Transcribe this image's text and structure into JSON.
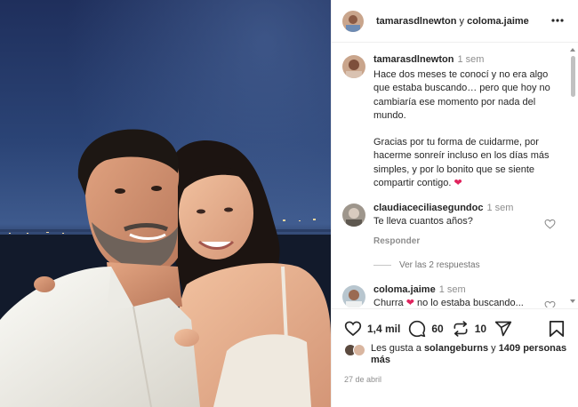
{
  "header": {
    "user1": "tamarasdlnewton",
    "joiner": " y ",
    "user2": "coloma.jaime"
  },
  "caption": {
    "user": "tamarasdlnewton",
    "time": "1 sem",
    "text": "Hace dos meses te conocí y no era algo que estaba buscando… pero que hoy no cambiaría ese momento por nada del mundo.\n\nGracias por tu forma de cuidarme, por hacerme sonreír incluso en los días más simples, y por lo bonito que se siente compartir contigo. ",
    "emoji": "❤"
  },
  "comment1": {
    "user": "claudiaceciliasegundoc",
    "time": "1 sem",
    "text": "Te lleva cuantos años?",
    "reply": "Responder",
    "view_replies": "Ver las 2 respuestas"
  },
  "comment2": {
    "user": "coloma.jaime",
    "time": "1 sem",
    "text_before": "Churra ",
    "emoji": "❤",
    "text_after": " no lo estaba buscando..."
  },
  "actions": {
    "likes": "1,4 mil",
    "comments": "60",
    "reposts": "10"
  },
  "liked_by": {
    "prefix": "Les gusta a ",
    "user": "solangeburns",
    "middle": " y ",
    "others": "1409 personas más"
  },
  "date": "27 de abril",
  "colors": {
    "heart": "#e0245e",
    "muted": "#8e8e8e",
    "text": "#262626"
  },
  "icons": [
    "more-icon",
    "heart-icon",
    "comment-icon",
    "repost-icon",
    "share-icon",
    "bookmark-icon"
  ]
}
